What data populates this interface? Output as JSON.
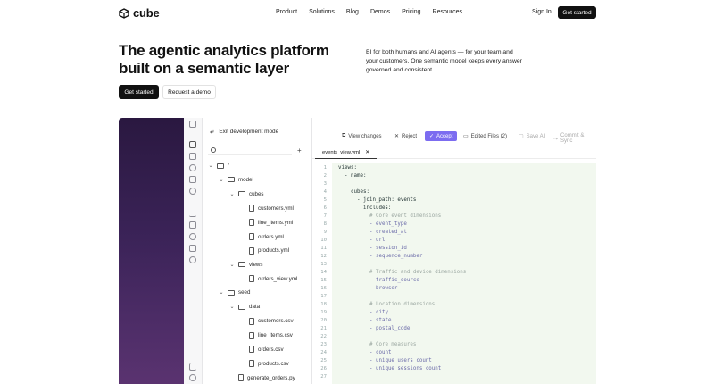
{
  "nav": {
    "logo_text": "cube",
    "links": [
      "Product",
      "Solutions",
      "Blog",
      "Demos",
      "Pricing",
      "Resources"
    ],
    "signin": "Sign In",
    "cta": "Get started"
  },
  "hero": {
    "title_line1": "The agentic analytics platform",
    "title_line2": "built on a semantic layer",
    "subtitle": "BI for both humans and AI agents — for your team and your customers. One semantic model keeps every answer governed and consistent.",
    "primary_cta": "Get started",
    "secondary_cta": "Request a demo"
  },
  "app": {
    "exit_dev": "Exit development mode",
    "toolbar": {
      "view_changes": "View changes",
      "reject": "Reject",
      "accept": "Accept",
      "edited_files": "Edited Files (2)",
      "save_all": "Save All",
      "commit": "Commit & Sync"
    },
    "tab": "events_view.yml",
    "tree": [
      {
        "label": "/",
        "kind": "folder",
        "indent": 0,
        "open": true
      },
      {
        "label": "model",
        "kind": "folder",
        "indent": 1,
        "open": true
      },
      {
        "label": "cubes",
        "kind": "folder",
        "indent": 2,
        "open": true
      },
      {
        "label": "customers.yml",
        "kind": "file",
        "indent": 3
      },
      {
        "label": "line_items.yml",
        "kind": "file",
        "indent": 3
      },
      {
        "label": "orders.yml",
        "kind": "file",
        "indent": 3
      },
      {
        "label": "products.yml",
        "kind": "file",
        "indent": 3
      },
      {
        "label": "views",
        "kind": "folder",
        "indent": 2,
        "open": true
      },
      {
        "label": "orders_view.yml",
        "kind": "file",
        "indent": 3
      },
      {
        "label": "seed",
        "kind": "folder",
        "indent": 1,
        "open": true
      },
      {
        "label": "data",
        "kind": "folder",
        "indent": 2,
        "open": true
      },
      {
        "label": "customers.csv",
        "kind": "file",
        "indent": 3
      },
      {
        "label": "line_items.csv",
        "kind": "file",
        "indent": 3
      },
      {
        "label": "orders.csv",
        "kind": "file",
        "indent": 3
      },
      {
        "label": "products.csv",
        "kind": "file",
        "indent": 3
      },
      {
        "label": "generate_orders.py",
        "kind": "file",
        "indent": 2
      }
    ],
    "code": [
      {
        "n": "1",
        "t": "views:",
        "cls": "k",
        "ind": 0
      },
      {
        "n": "2",
        "t": "- name:",
        "cls": "k",
        "ind": 1
      },
      {
        "n": "3",
        "t": "",
        "cls": "k",
        "ind": 0
      },
      {
        "n": "4",
        "t": "cubes:",
        "cls": "k",
        "ind": 2
      },
      {
        "n": "5",
        "t": "- join_path: events",
        "cls": "k",
        "ind": 3
      },
      {
        "n": "6",
        "t": "includes:",
        "cls": "k",
        "ind": 4
      },
      {
        "n": "7",
        "t": "# Core event dimensions",
        "cls": "c",
        "ind": 5
      },
      {
        "n": "8",
        "t": "- event_type",
        "cls": "p",
        "ind": 5
      },
      {
        "n": "9",
        "t": "- created_at",
        "cls": "p",
        "ind": 5
      },
      {
        "n": "10",
        "t": "- url",
        "cls": "p",
        "ind": 5
      },
      {
        "n": "11",
        "t": "- session_id",
        "cls": "p",
        "ind": 5
      },
      {
        "n": "12",
        "t": "- sequence_number",
        "cls": "p",
        "ind": 5
      },
      {
        "n": "13",
        "t": "",
        "cls": "k",
        "ind": 0
      },
      {
        "n": "14",
        "t": "# Traffic and device dimensions",
        "cls": "c",
        "ind": 5
      },
      {
        "n": "15",
        "t": "- traffic_source",
        "cls": "p",
        "ind": 5
      },
      {
        "n": "16",
        "t": "- browser",
        "cls": "p",
        "ind": 5
      },
      {
        "n": "17",
        "t": "",
        "cls": "k",
        "ind": 0
      },
      {
        "n": "18",
        "t": "# Location dimensions",
        "cls": "c",
        "ind": 5
      },
      {
        "n": "19",
        "t": "- city",
        "cls": "p",
        "ind": 5
      },
      {
        "n": "20",
        "t": "- state",
        "cls": "p",
        "ind": 5
      },
      {
        "n": "21",
        "t": "- postal_code",
        "cls": "p",
        "ind": 5
      },
      {
        "n": "22",
        "t": "",
        "cls": "k",
        "ind": 0
      },
      {
        "n": "23",
        "t": "# Core measures",
        "cls": "c",
        "ind": 5
      },
      {
        "n": "24",
        "t": "- count",
        "cls": "p",
        "ind": 5
      },
      {
        "n": "25",
        "t": "- unique_users_count",
        "cls": "p",
        "ind": 5
      },
      {
        "n": "26",
        "t": "- unique_sessions_count",
        "cls": "p",
        "ind": 5
      },
      {
        "n": "27",
        "t": "",
        "cls": "k",
        "ind": 0
      }
    ]
  }
}
